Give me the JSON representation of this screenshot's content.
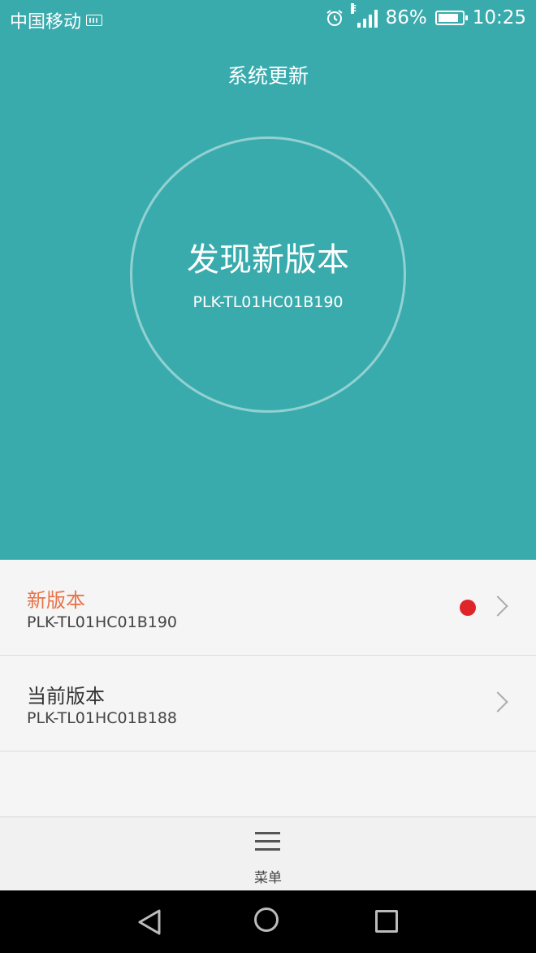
{
  "status_bar": {
    "carrier": "中国移动",
    "battery_percent": "86%",
    "battery_level": 0.86,
    "time": "10:25",
    "network_type": "E",
    "icons": [
      "keyboard-icon",
      "alarm-icon",
      "signal-icon",
      "battery-icon"
    ]
  },
  "header": {
    "title": "系统更新"
  },
  "hero": {
    "main_text": "发现新版本",
    "version": "PLK-TL01HC01B190"
  },
  "list": {
    "items": [
      {
        "title": "新版本",
        "subtitle": "PLK-TL01HC01B190",
        "has_badge": true,
        "title_color": "#e9744a"
      },
      {
        "title": "当前版本",
        "subtitle": "PLK-TL01HC01B188",
        "has_badge": false,
        "title_color": "#333333"
      }
    ]
  },
  "bottom_bar": {
    "menu_label": "菜单"
  },
  "colors": {
    "primary": "#3aabad",
    "accent": "#e9744a",
    "badge": "#e0252a"
  }
}
